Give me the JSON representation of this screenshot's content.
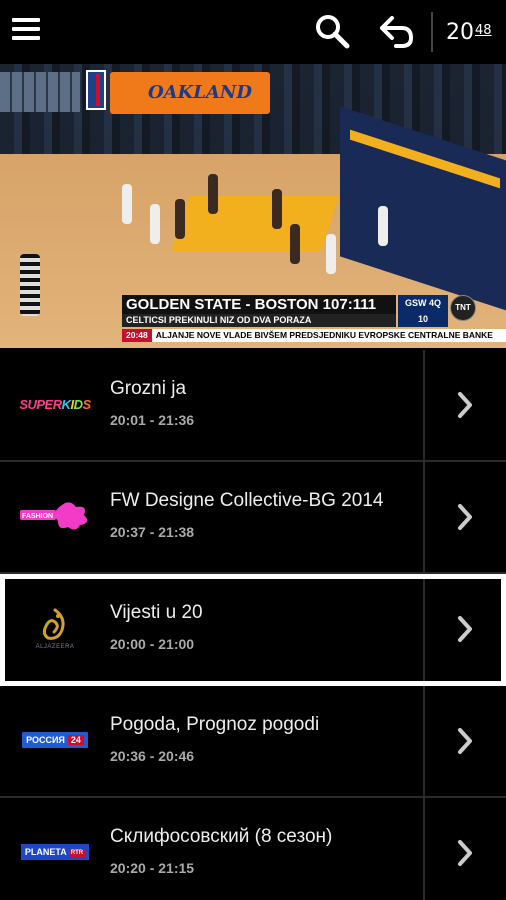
{
  "topbar": {
    "clock_hours": "20",
    "clock_minutes": "48",
    "icons": [
      "menu-icon",
      "search-icon",
      "back-arrow-icon"
    ]
  },
  "video": {
    "banner_text": "OAKLAND",
    "scoreboard": {
      "headline": "GOLDEN STATE - BOSTON 107:111",
      "subline": "CELTICSI PREKINULI NIZ OD DVA PORAZA",
      "quarter_label": "GSW",
      "quarter_value": "4Q",
      "clock_value": "10",
      "network": "TNT"
    },
    "ticker": {
      "time": "20:48",
      "text": "ALJANJE NOVE VLADE BIVŠEM PREDSJEDNIKU EVROPSKE CENTRALNE BANKE"
    }
  },
  "channels": [
    {
      "logo": "SUPERKIDS",
      "title": "Grozni ja",
      "time": "20:01 - 21:36",
      "selected": false
    },
    {
      "logo": "FASHION",
      "title": "FW Designe Collective-BG 2014",
      "time": "20:37 - 21:38",
      "selected": false
    },
    {
      "logo": "ALJAZEERA",
      "title": "Vijesti u 20",
      "time": "20:00 - 21:00",
      "selected": true
    },
    {
      "logo_main": "РОССИЯ",
      "logo_num": "24",
      "title": "Pogoda, Prognoz pogodi",
      "time": "20:36 - 20:46",
      "selected": false
    },
    {
      "logo_main": "PLANETA",
      "logo_sub": "RTR",
      "title": "Склифосовский (8 сезон)",
      "time": "20:20 - 21:15",
      "selected": false
    }
  ],
  "colors": {
    "background": "#000000",
    "selected_border": "#ffffff",
    "divider": "#2a2a2a",
    "superkids_pink": "#e6248c",
    "fashion_pink": "#f23cc8",
    "aljazeera_gold": "#d4a22a",
    "rossiya_blue": "#1f5bd1",
    "accent_red": "#c8102e"
  }
}
